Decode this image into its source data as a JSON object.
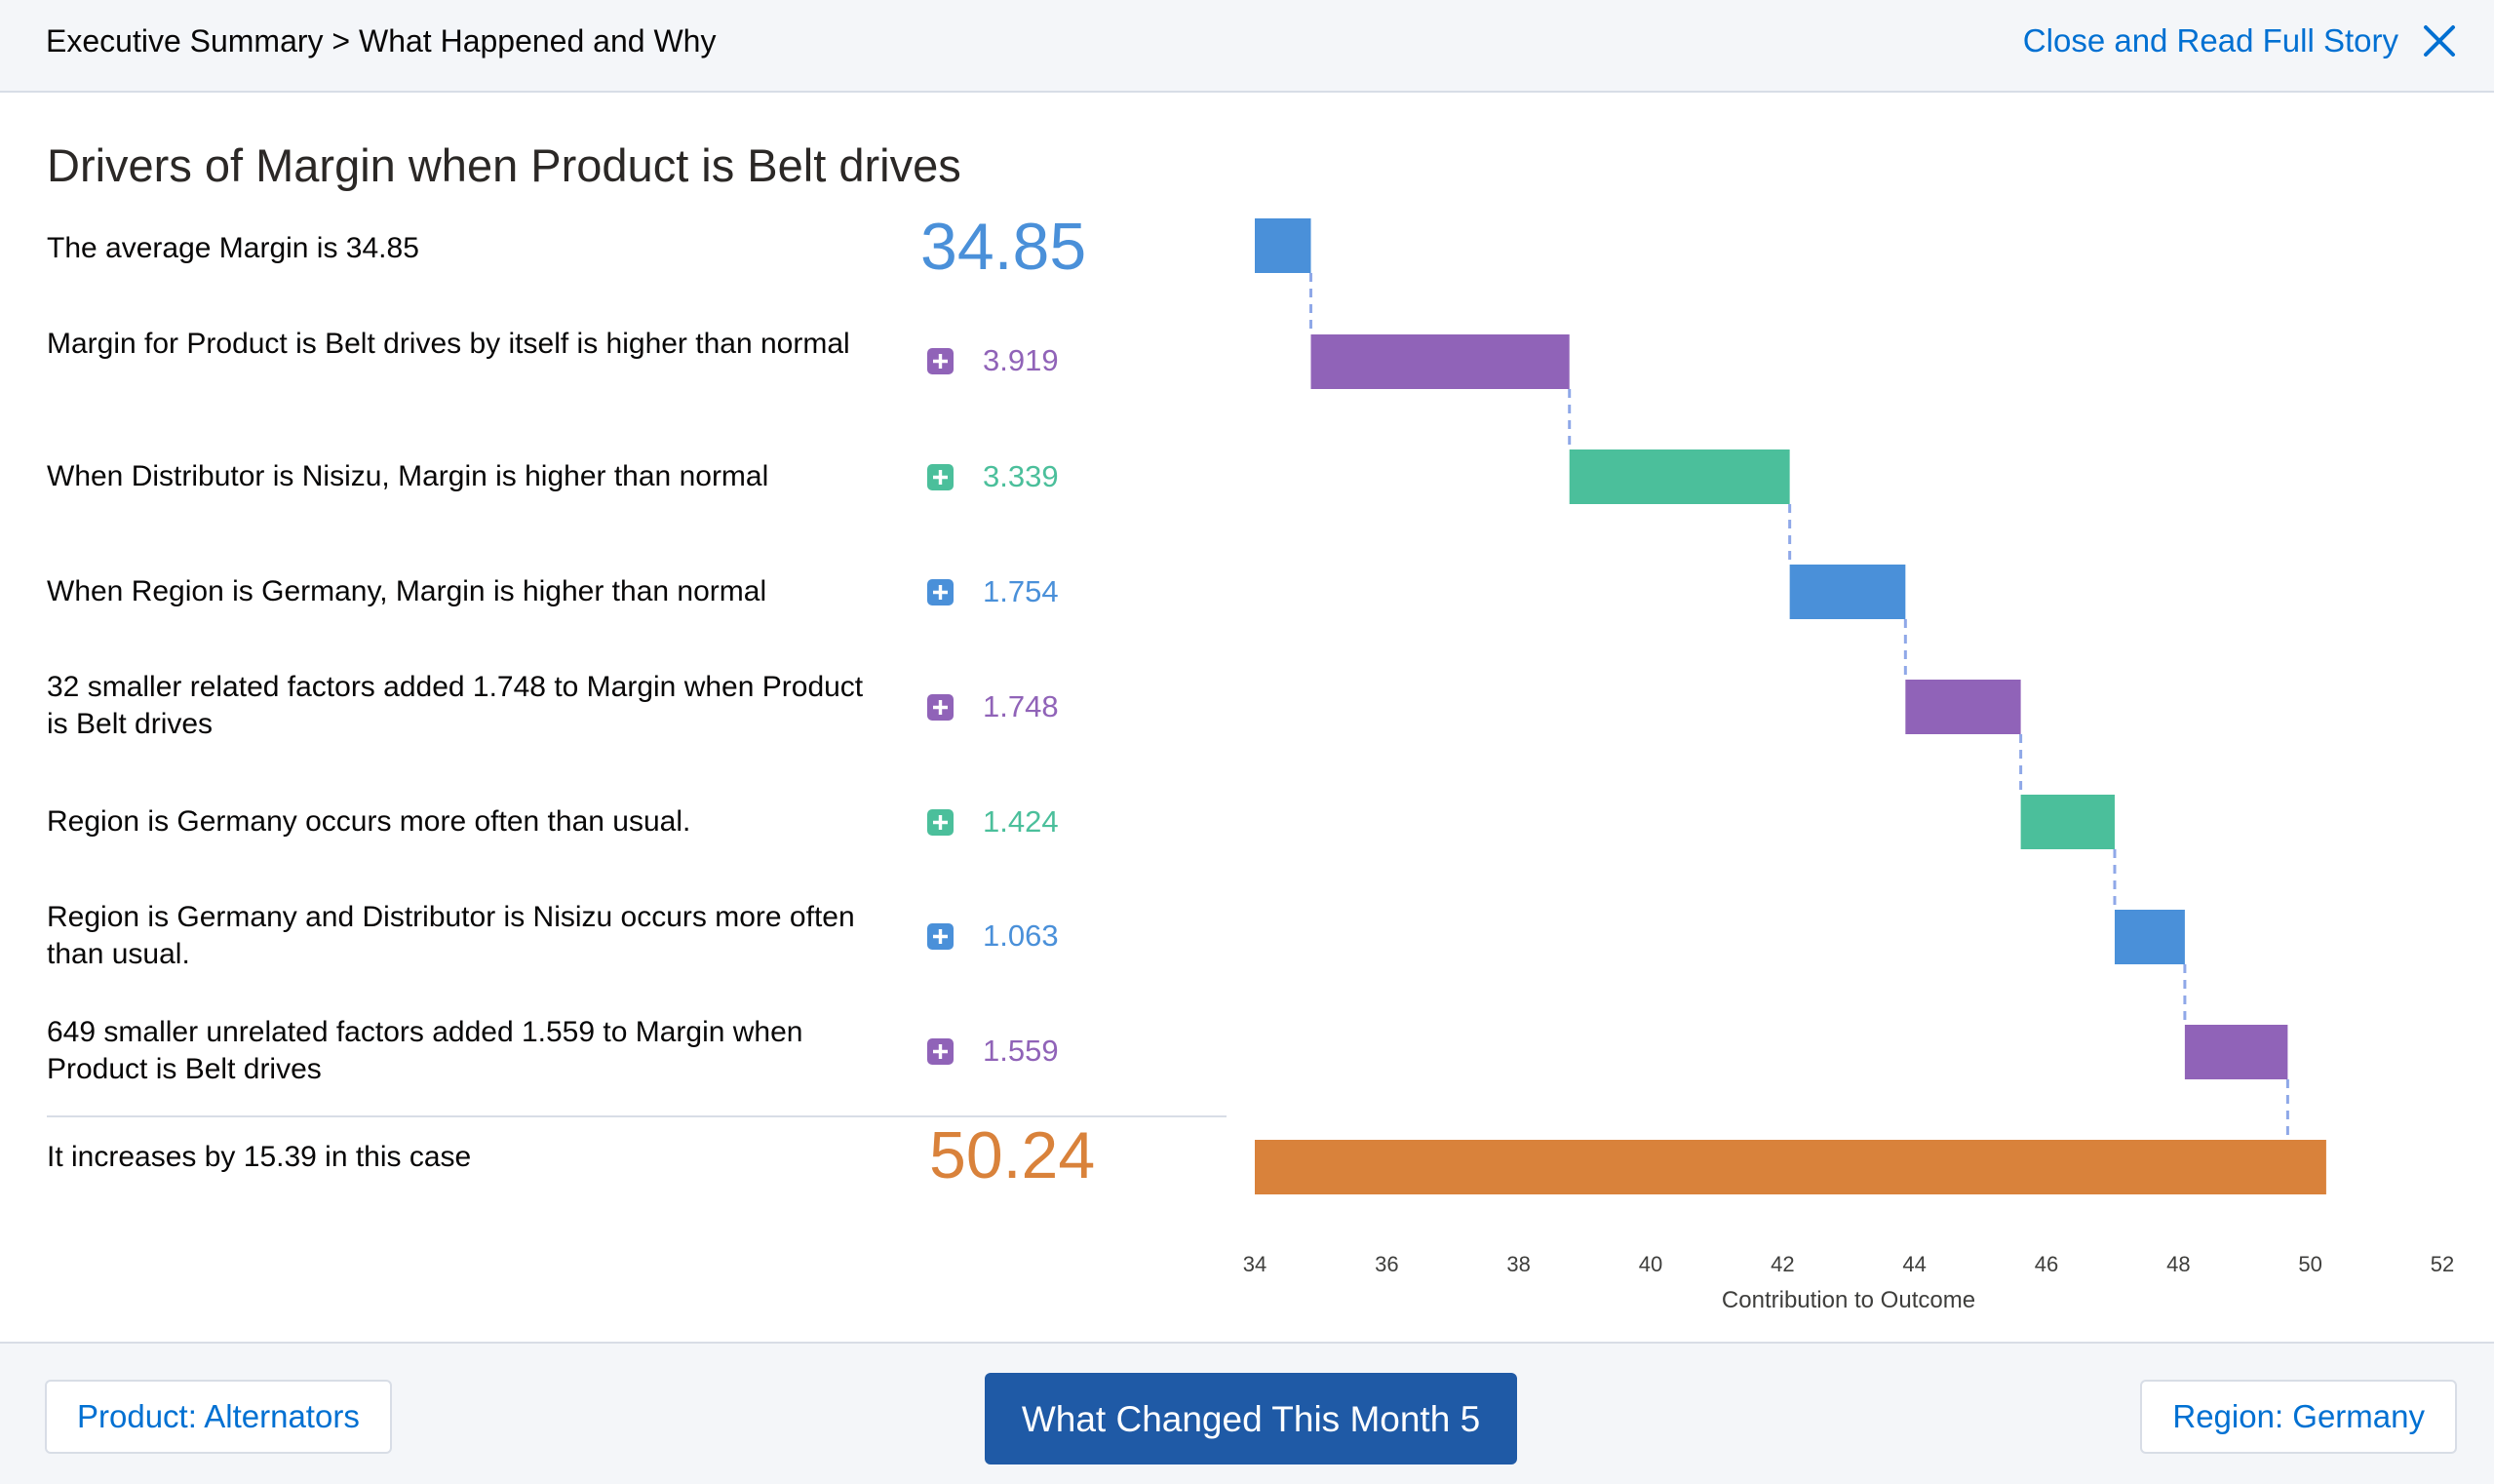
{
  "header": {
    "breadcrumb": "Executive Summary > What Happened and Why",
    "close_label": "Close and Read Full Story"
  },
  "title": "Drivers of Margin when Product is Belt drives",
  "average": {
    "label": "The average Margin is 34.85",
    "value": "34.85"
  },
  "factors": [
    {
      "label": "Margin for Product is Belt drives by itself is higher than normal",
      "value": "3.919",
      "color": "#9063b8"
    },
    {
      "label": "When Distributor is Nisizu, Margin is higher than normal",
      "value": "3.339",
      "color": "#4bbf9b"
    },
    {
      "label": "When Region is Germany, Margin is higher than normal",
      "value": "1.754",
      "color": "#4a90d9"
    },
    {
      "label": "32 smaller related factors added 1.748 to Margin when Product is Belt drives",
      "value": "1.748",
      "color": "#9063b8"
    },
    {
      "label": "Region is Germany occurs more often than usual.",
      "value": "1.424",
      "color": "#4bbf9b"
    },
    {
      "label": "Region is Germany and Distributor is Nisizu occurs more often than usual.",
      "value": "1.063",
      "color": "#4a90d9"
    },
    {
      "label": "649 smaller unrelated factors added 1.559 to Margin when Product is Belt drives",
      "value": "1.559",
      "color": "#9063b8"
    }
  ],
  "total": {
    "label": "It increases by 15.39 in this case",
    "value": "50.24"
  },
  "colors": {
    "blue": "#4a90d9",
    "purple": "#9063b8",
    "green": "#4bbf9b",
    "orange": "#d9823b",
    "connector": "#8fa8e8",
    "link": "#0070d2",
    "avg_value": "#4a90d9",
    "total_value": "#d9823b"
  },
  "chart_data": {
    "type": "bar",
    "subtype": "waterfall",
    "orientation": "horizontal",
    "base": 34.85,
    "steps": [
      {
        "start": 34.85,
        "end": 38.769,
        "delta": 3.919,
        "color": "#9063b8"
      },
      {
        "start": 38.769,
        "end": 42.108,
        "delta": 3.339,
        "color": "#4bbf9b"
      },
      {
        "start": 42.108,
        "end": 43.862,
        "delta": 1.754,
        "color": "#4a90d9"
      },
      {
        "start": 43.862,
        "end": 45.61,
        "delta": 1.748,
        "color": "#9063b8"
      },
      {
        "start": 45.61,
        "end": 47.034,
        "delta": 1.424,
        "color": "#4bbf9b"
      },
      {
        "start": 47.034,
        "end": 48.097,
        "delta": 1.063,
        "color": "#4a90d9"
      },
      {
        "start": 48.097,
        "end": 49.656,
        "delta": 1.559,
        "color": "#9063b8"
      }
    ],
    "first_bar": {
      "start": 34,
      "end": 34.85,
      "color": "#4a90d9"
    },
    "total_bar": {
      "start": 34,
      "end": 50.24,
      "color": "#d9823b"
    },
    "xlim": [
      34,
      52
    ],
    "xticks": [
      34,
      36,
      38,
      40,
      42,
      44,
      46,
      48,
      50,
      52
    ],
    "xlabel": "Contribution to Outcome",
    "grid": false
  },
  "footer": {
    "prev_label": "Product: Alternators",
    "primary_label": "What Changed This Month 5",
    "next_label": "Region: Germany"
  }
}
